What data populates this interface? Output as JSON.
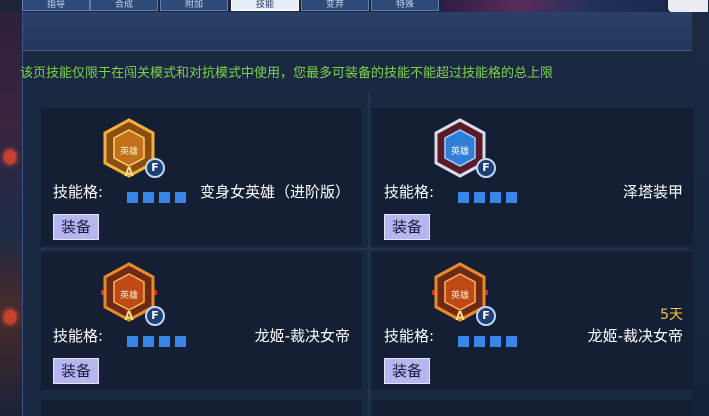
{
  "tabs": [
    {
      "label": "指导"
    },
    {
      "label": "合成"
    },
    {
      "label": "附加"
    },
    {
      "label": "技能"
    },
    {
      "label": "变弃"
    },
    {
      "label": "特殊"
    }
  ],
  "active_tab_index": 3,
  "notice": "该页技能仅限于在闯关模式和对抗模式中使用，您最多可装备的技能不能超过技能格的总上限",
  "skills": [
    {
      "badge_text": "英雄",
      "rank": "A",
      "f_mark": "F",
      "slot_label": "技能格:",
      "slot_count": 4,
      "name": "变身女英雄（进阶版）",
      "equip_label": "装备",
      "style": "gold"
    },
    {
      "badge_text": "英雄",
      "rank": "",
      "f_mark": "F",
      "slot_label": "技能格:",
      "slot_count": 4,
      "name": "泽塔装甲",
      "equip_label": "装备",
      "style": "blue"
    },
    {
      "badge_text": "英雄",
      "rank": "A",
      "f_mark": "F",
      "slot_label": "技能格:",
      "slot_count": 4,
      "name": "龙姬-裁决女帝",
      "equip_label": "装备",
      "style": "red"
    },
    {
      "badge_text": "英雄",
      "rank": "A",
      "f_mark": "F",
      "slot_label": "技能格:",
      "slot_count": 4,
      "name": "龙姬-裁决女帝",
      "equip_label": "装备",
      "style": "red",
      "days": "5天"
    }
  ],
  "colors": {
    "notice": "#7fd24a",
    "slot_square": "#3a86e6",
    "equip_button": "#b6b7f2",
    "days": "#f0c845",
    "panel": "#1a2842"
  }
}
